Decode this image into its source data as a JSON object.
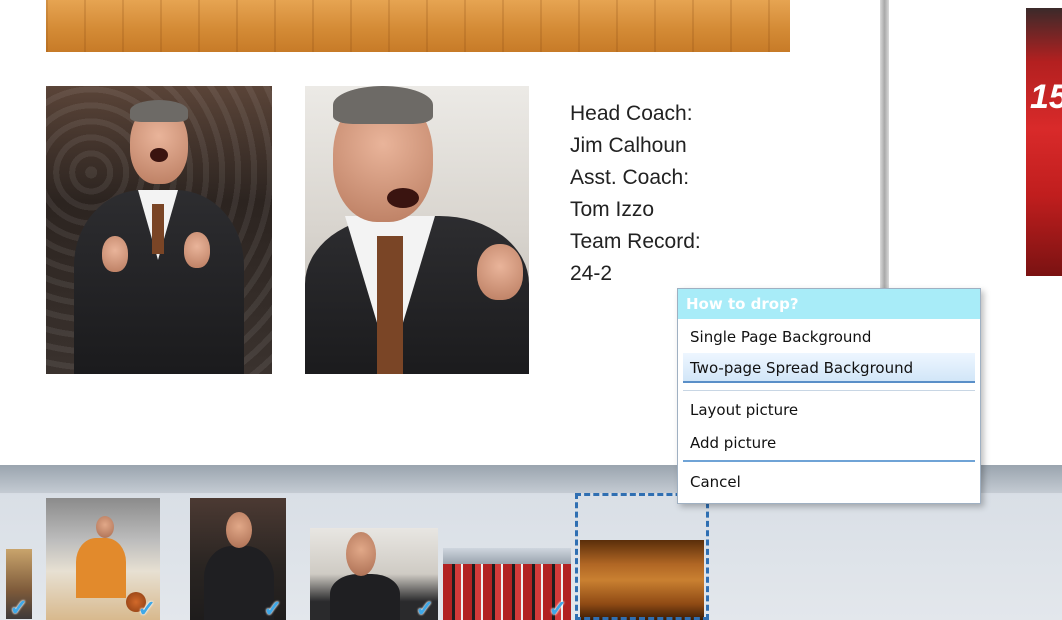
{
  "coach_info": {
    "lines": [
      "Head Coach:",
      "Jim Calhoun",
      "Asst. Coach:",
      "Tom Izzo",
      "Team Record:",
      "24-2"
    ]
  },
  "right_page": {
    "jersey_number": "15"
  },
  "context_menu": {
    "title": "How to drop?",
    "items": [
      {
        "label": "Single Page Background"
      },
      {
        "label": "Two-page Spread Background",
        "highlighted": true
      },
      {
        "label": "Layout picture"
      },
      {
        "label": "Add picture"
      },
      {
        "label": "Cancel"
      }
    ]
  },
  "filmstrip": {
    "check_glyph": "✓",
    "thumbnails": [
      {
        "name": "player-thumb-partial",
        "checked": true
      },
      {
        "name": "player-dribbling-thumb",
        "checked": true
      },
      {
        "name": "coach-calhoun-thumb",
        "checked": true
      },
      {
        "name": "coach-izzo-thumb",
        "checked": true
      },
      {
        "name": "team-photo-thumb",
        "checked": true
      },
      {
        "name": "hardwood-floor-thumb",
        "checked": false,
        "drop_target": true
      }
    ]
  },
  "colors": {
    "menu_header": "#a8ecf8",
    "menu_highlight_border": "#5a8fc8",
    "drop_target_border": "#2f6fb2",
    "check": "#3fa8e8"
  }
}
